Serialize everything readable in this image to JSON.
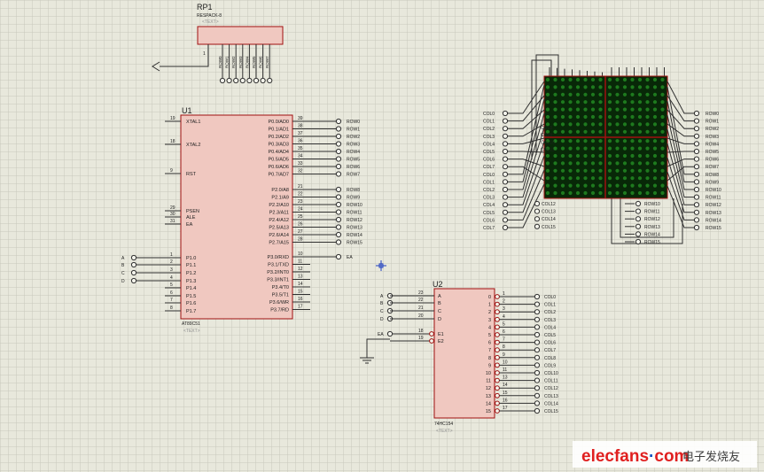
{
  "rp1": {
    "ref": "RP1",
    "part": "RESPACK-8",
    "text": "<TEXT>",
    "pins": [
      "ROW0",
      "ROW1",
      "ROW2",
      "ROW3",
      "ROW4",
      "ROW5",
      "ROW6",
      "ROW7"
    ],
    "common_pin": "1"
  },
  "u1": {
    "ref": "U1",
    "part": "AT89C51",
    "text": "<TEXT>",
    "left_pins": [
      {
        "num": "19",
        "name": "XTAL1"
      },
      {
        "num": "18",
        "name": "XTAL2"
      },
      {
        "num": "9",
        "name": "RST"
      },
      {
        "num": "29",
        "name": "PSEN"
      },
      {
        "num": "30",
        "name": "ALE"
      },
      {
        "num": "31",
        "name": "EA"
      },
      {
        "num": "1",
        "name": "P1.0"
      },
      {
        "num": "2",
        "name": "P1.1"
      },
      {
        "num": "3",
        "name": "P1.2"
      },
      {
        "num": "4",
        "name": "P1.3"
      },
      {
        "num": "5",
        "name": "P1.4"
      },
      {
        "num": "6",
        "name": "P1.5"
      },
      {
        "num": "7",
        "name": "P1.6"
      },
      {
        "num": "8",
        "name": "P1.7"
      }
    ],
    "left_nets": [
      "A",
      "B",
      "C",
      "D"
    ],
    "right_pins": [
      {
        "num": "39",
        "name": "P0.0/AD0",
        "net": "ROW0"
      },
      {
        "num": "38",
        "name": "P0.1/AD1",
        "net": "ROW1"
      },
      {
        "num": "37",
        "name": "P0.2/AD2",
        "net": "ROW2"
      },
      {
        "num": "36",
        "name": "P0.3/AD3",
        "net": "ROW3"
      },
      {
        "num": "35",
        "name": "P0.4/AD4",
        "net": "ROW4"
      },
      {
        "num": "34",
        "name": "P0.5/AD5",
        "net": "ROW5"
      },
      {
        "num": "33",
        "name": "P0.6/AD6",
        "net": "ROW6"
      },
      {
        "num": "32",
        "name": "P0.7/AD7",
        "net": "ROW7"
      },
      {
        "num": "21",
        "name": "P2.0/A8",
        "net": "ROW8"
      },
      {
        "num": "22",
        "name": "P2.1/A9",
        "net": "ROW9"
      },
      {
        "num": "23",
        "name": "P2.2/A10",
        "net": "ROW10"
      },
      {
        "num": "24",
        "name": "P2.3/A11",
        "net": "ROW11"
      },
      {
        "num": "25",
        "name": "P2.4/A12",
        "net": "ROW12"
      },
      {
        "num": "26",
        "name": "P2.5/A13",
        "net": "ROW13"
      },
      {
        "num": "27",
        "name": "P2.6/A14",
        "net": "ROW14"
      },
      {
        "num": "28",
        "name": "P2.7/A15",
        "net": "ROW15"
      },
      {
        "num": "10",
        "name": "P3.0/RXD",
        "net": "EA"
      },
      {
        "num": "11",
        "name": "P3.1/TXD",
        "net": ""
      },
      {
        "num": "12",
        "name": "P3.2/INT0",
        "net": ""
      },
      {
        "num": "13",
        "name": "P3.3/INT1",
        "net": ""
      },
      {
        "num": "14",
        "name": "P3.4/T0",
        "net": ""
      },
      {
        "num": "15",
        "name": "P3.5/T1",
        "net": ""
      },
      {
        "num": "16",
        "name": "P3.6/WR",
        "net": ""
      },
      {
        "num": "17",
        "name": "P3.7/RD",
        "net": ""
      }
    ]
  },
  "u2": {
    "ref": "U2",
    "part": "74HC154",
    "text": "<TEXT>",
    "inputs": [
      {
        "net": "A",
        "num": "23",
        "name": "A"
      },
      {
        "net": "B",
        "num": "22",
        "name": "B"
      },
      {
        "net": "C",
        "num": "21",
        "name": "C"
      },
      {
        "net": "D",
        "num": "20",
        "name": "D"
      }
    ],
    "enables": [
      {
        "net": "EA",
        "num": "18",
        "name": "E1"
      },
      {
        "net": "",
        "num": "19",
        "name": "E2"
      }
    ],
    "outputs": [
      {
        "idx": "0",
        "num": "1",
        "net": "COL0"
      },
      {
        "idx": "1",
        "num": "2",
        "net": "COL1"
      },
      {
        "idx": "2",
        "num": "3",
        "net": "COL2"
      },
      {
        "idx": "3",
        "num": "4",
        "net": "COL3"
      },
      {
        "idx": "4",
        "num": "5",
        "net": "COL4"
      },
      {
        "idx": "5",
        "num": "6",
        "net": "COL5"
      },
      {
        "idx": "6",
        "num": "7",
        "net": "COL6"
      },
      {
        "idx": "7",
        "num": "8",
        "net": "COL7"
      },
      {
        "idx": "8",
        "num": "9",
        "net": "COL8"
      },
      {
        "idx": "9",
        "num": "10",
        "net": "COL9"
      },
      {
        "idx": "10",
        "num": "11",
        "net": "COL10"
      },
      {
        "idx": "11",
        "num": "13",
        "net": "COL11"
      },
      {
        "idx": "12",
        "num": "14",
        "net": "COL12"
      },
      {
        "idx": "13",
        "num": "15",
        "net": "COL13"
      },
      {
        "idx": "14",
        "num": "16",
        "net": "COL14"
      },
      {
        "idx": "15",
        "num": "17",
        "net": "COL15"
      }
    ]
  },
  "matrix": {
    "left_labels": [
      "COL0",
      "COL1",
      "COL2",
      "COL3",
      "COL4",
      "COL5",
      "COL6",
      "COL7",
      "COL0",
      "COL1",
      "COL2",
      "COL3",
      "COL4",
      "COL5",
      "COL6",
      "COL7"
    ],
    "inner_labels": [
      "COL8",
      "COL9",
      "COL10",
      "COL11",
      "COL12",
      "COL13",
      "COL14",
      "COL15"
    ],
    "right_labels": [
      "ROW0",
      "ROW1",
      "ROW2",
      "ROW3",
      "ROW4",
      "ROW5",
      "ROW6",
      "ROW7",
      "ROW8",
      "ROW9",
      "ROW10",
      "ROW11",
      "ROW12",
      "ROW13",
      "ROW14",
      "ROW15"
    ]
  },
  "watermark": {
    "site": "elecfans",
    "dot": "·",
    "tld": "com",
    "cn": "电子发烧友"
  },
  "colors": {
    "background": "#e8e8dc",
    "grid": "#c8c8bc",
    "body_fill": "#f0c8c0",
    "body_stroke": "#a01010",
    "wire": "#303030",
    "matrix_dark": "#082808",
    "led": "#1e7a1e",
    "watermark_red": "#e02020",
    "watermark_blue": "#1050c0"
  }
}
